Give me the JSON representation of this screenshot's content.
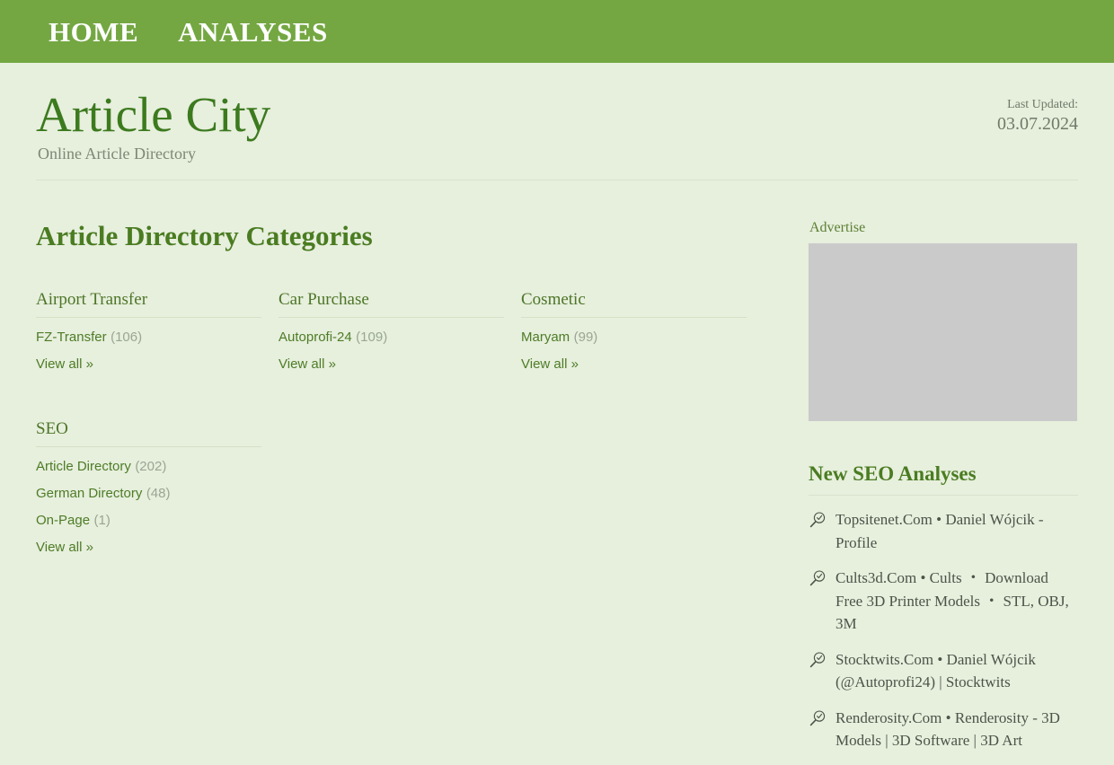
{
  "nav": {
    "items": [
      {
        "label": "HOME"
      },
      {
        "label": "ANALYSES"
      }
    ]
  },
  "header": {
    "title": "Article City",
    "tagline": "Online Article Directory",
    "last_updated_label": "Last Updated:",
    "last_updated_date": "03.07.2024"
  },
  "main": {
    "page_heading": "Article Directory Categories",
    "view_all_label": "View all »",
    "categories": [
      {
        "title": "Airport Transfer",
        "links": [
          {
            "label": "FZ-Transfer",
            "count": "(106)"
          }
        ]
      },
      {
        "title": "Car Purchase",
        "links": [
          {
            "label": "Autoprofi-24",
            "count": "(109)"
          }
        ]
      },
      {
        "title": "Cosmetic",
        "links": [
          {
            "label": "Maryam",
            "count": "(99)"
          }
        ]
      },
      {
        "title": "SEO",
        "links": [
          {
            "label": "Article Directory",
            "count": "(202)"
          },
          {
            "label": "German Directory",
            "count": "(48)"
          },
          {
            "label": "On-Page",
            "count": "(1)"
          }
        ]
      }
    ]
  },
  "sidebar": {
    "advertise_label": "Advertise",
    "ad_placeholder_color": "#cacaca",
    "analyses_heading": "New SEO Analyses",
    "analyses": [
      {
        "icon": "magnifier-check-icon",
        "label": "Topsitenet.Com • Daniel Wójcik - Profile"
      },
      {
        "icon": "magnifier-check-icon",
        "label": "Cults3d.Com • Cults ・ Download Free 3D Printer Models ・ STL, OBJ, 3M"
      },
      {
        "icon": "magnifier-check-icon",
        "label": "Stocktwits.Com • Daniel Wójcik (@Autoprofi24) | Stocktwits"
      },
      {
        "icon": "magnifier-check-icon",
        "label": "Renderosity.Com • Renderosity - 3D Models | 3D Software | 3D Art"
      }
    ]
  },
  "colors": {
    "nav_green": "#74a742",
    "page_background": "#e7efdd",
    "brand_green": "#3c7a1e",
    "link_green": "#4d7c26"
  }
}
